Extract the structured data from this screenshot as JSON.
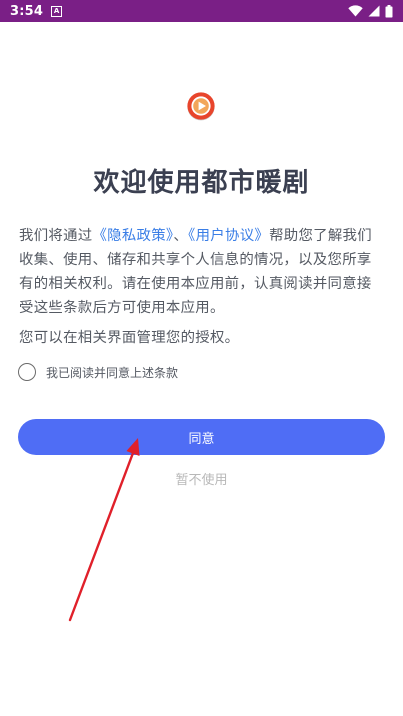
{
  "status_bar": {
    "time": "3:54",
    "notification_icon_letter": "A",
    "icons": [
      "wifi-icon",
      "signal-icon",
      "battery-icon"
    ]
  },
  "dialog": {
    "title": "欢迎使用都市暖剧",
    "desc_part1": "我们将通过",
    "privacy_link": "《隐私政策》",
    "desc_sep": "、",
    "user_agreement_link": "《用户协议》",
    "desc_part2": "帮助您了解我们收集、使用、储存和共享个人信息的情况，以及您所享有的相关权利。请在使用本应用前，认真阅读并同意接受这些条款后方可使用本应用。",
    "manage_note": "您可以在相关界面管理您的授权。",
    "checkbox_label": "我已阅读并同意上述条款",
    "agree_button": "同意",
    "decline_button": "暂不使用"
  },
  "colors": {
    "status_bar": "#7a1f86",
    "primary": "#4f6df5",
    "link": "#3a7ee6",
    "logo": "#e8452c",
    "arrow": "#e0202a"
  }
}
